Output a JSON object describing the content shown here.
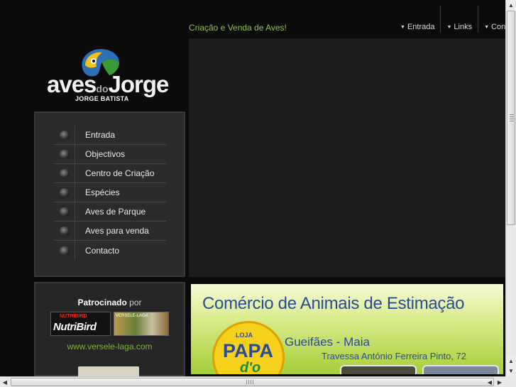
{
  "header": {
    "tagline": "Criação e Venda de Aves!",
    "nav": [
      {
        "label": "Entrada"
      },
      {
        "label": "Links"
      },
      {
        "label": "Contacto"
      }
    ]
  },
  "logo": {
    "name_part1": "aves",
    "name_part2": "do",
    "name_part3": "Jorge",
    "subtitle": "JORGE BATISTA"
  },
  "menu": {
    "items": [
      {
        "label": "Entrada"
      },
      {
        "label": "Objectivos"
      },
      {
        "label": "Centro de Criação"
      },
      {
        "label": "Espécies"
      },
      {
        "label": "Aves de Parque"
      },
      {
        "label": "Aves para venda"
      },
      {
        "label": "Contacto"
      }
    ]
  },
  "sponsor": {
    "heading_bold": "Patrocinado",
    "heading_rest": "por",
    "nutribird_label": "NutriBird",
    "nutribird_small": "NUTRIBIRD",
    "versele_label": "VERSELE-LAGA",
    "url": "www.versele-laga.com"
  },
  "ad": {
    "title": "Comércio de Animais de Estimação",
    "place": "Gueifães - Maia",
    "address": "Travessa António Ferreira Pinto, 72",
    "badge_top": "LOJA",
    "badge_main": "PAPA",
    "badge_bottom": "d'o"
  },
  "colors": {
    "background": "#0b0b0b",
    "accent_green": "#8fc540",
    "menu_panel": "#2b2b2b",
    "ad_blue": "#2a4a9a"
  }
}
